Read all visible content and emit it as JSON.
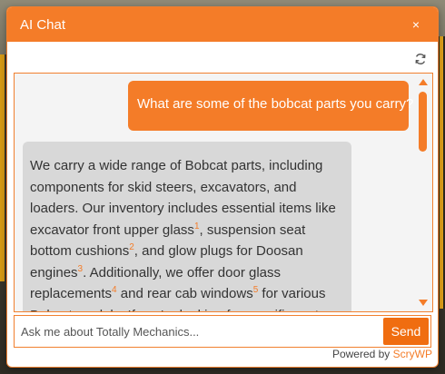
{
  "chat": {
    "title": "AI Chat",
    "close_symbol": "×",
    "user_message": "What are some of the bobcat parts you carry?",
    "bot_message": {
      "p1": "We carry a wide range of Bobcat parts, including components for skid steers, excavators, and loaders. Our inventory includes essential items like excavator front upper glass",
      "ref1": "1",
      "p2": ", suspension seat bottom cushions",
      "ref2": "2",
      "p3": ", and glow plugs for Doosan engines",
      "ref3": "3",
      "p4": ". Additionally, we offer door glass replacements",
      "ref4": "4",
      "p5": " and rear cab windows",
      "ref5": "5",
      "p6": " for various Bobcat models. If you're looking for specific parts, feel free to ask!"
    },
    "input_placeholder": "Ask me about Totally Mechanics...",
    "input_value": "",
    "send_label": "Send",
    "powered_by": "Powered by",
    "brand": "ScryWP"
  },
  "colors": {
    "accent": "#f47c28",
    "bot_bubble": "#d8d8d8",
    "panel_bg": "#f4f4f4"
  },
  "icons": {
    "refresh": "refresh-icon",
    "close": "close-icon",
    "scroll_up": "arrow-up-icon",
    "scroll_down": "arrow-down-icon"
  }
}
